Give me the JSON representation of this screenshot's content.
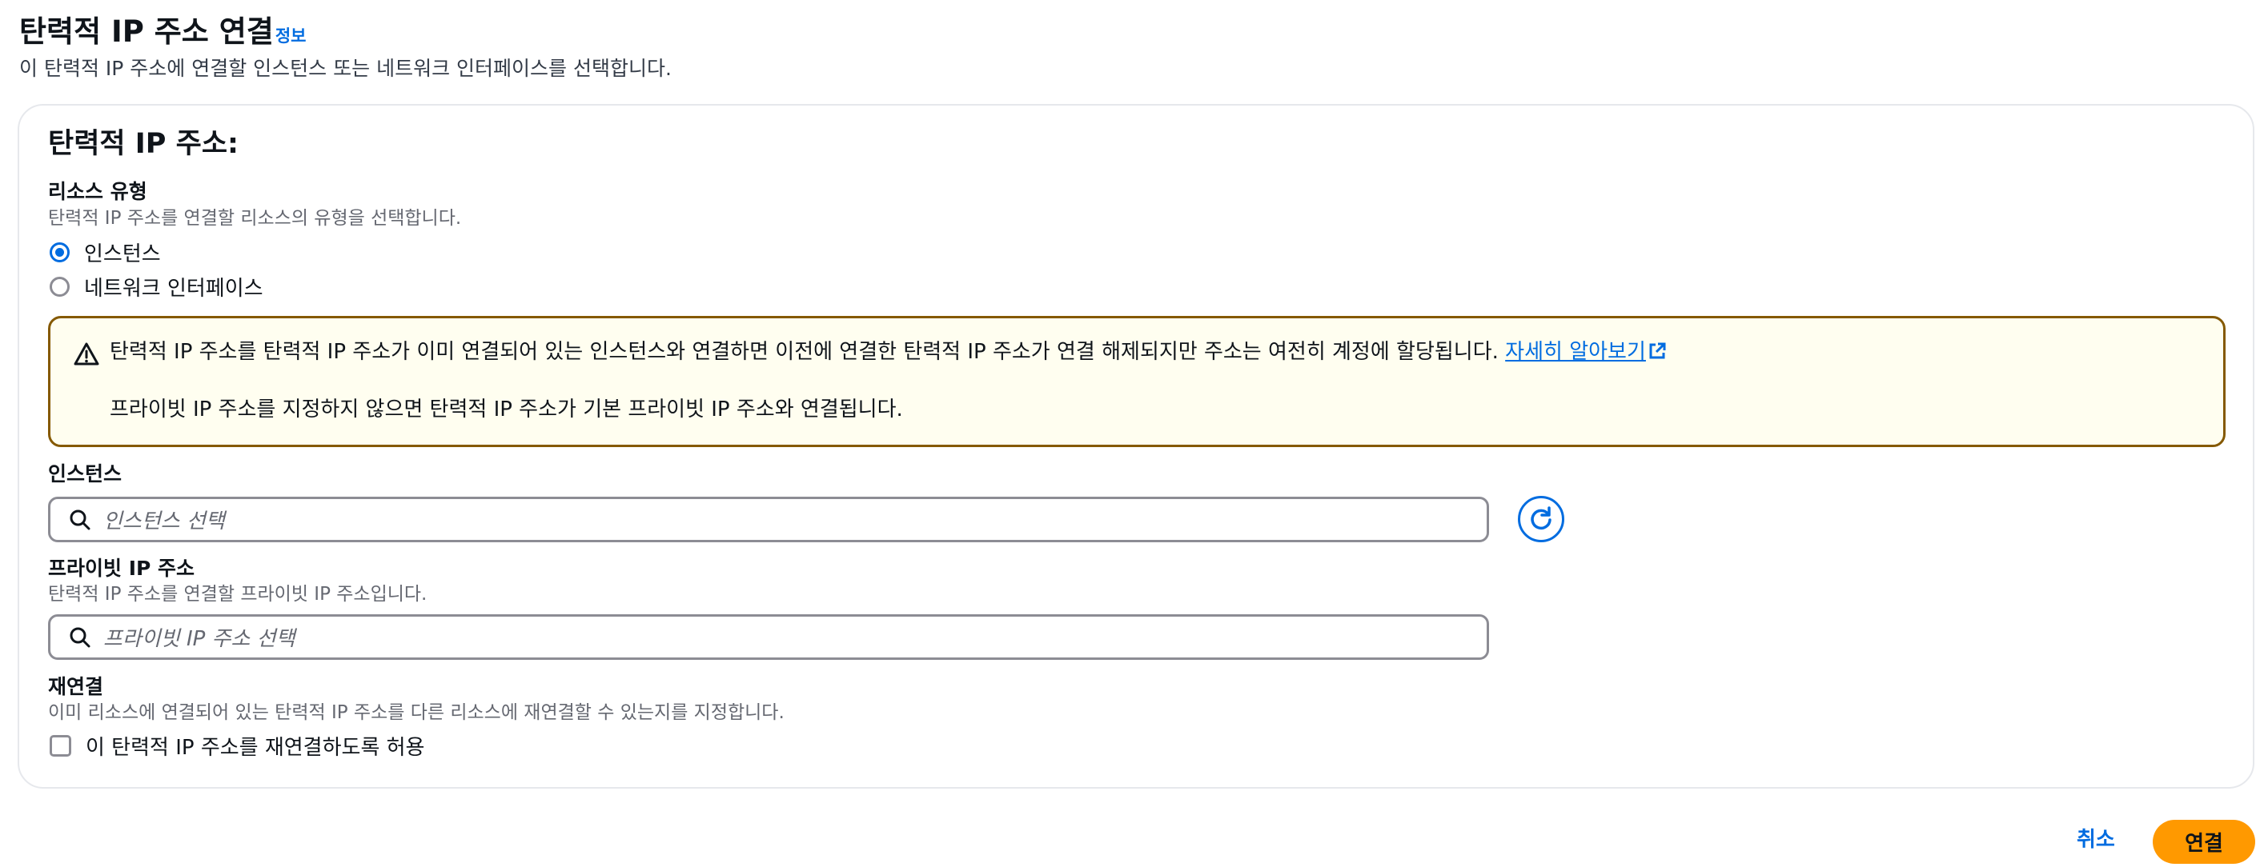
{
  "header": {
    "title": "탄력적 IP 주소 연결",
    "info_link": "정보",
    "description": "이 탄력적 IP 주소에 연결할 인스턴스 또는 네트워크 인터페이스를 선택합니다."
  },
  "section": {
    "title": "탄력적 IP 주소:"
  },
  "resource_type": {
    "label": "리소스 유형",
    "description": "탄력적 IP 주소를 연결할 리소스의 유형을 선택합니다.",
    "options": [
      {
        "label": "인스턴스",
        "checked": true
      },
      {
        "label": "네트워크 인터페이스",
        "checked": false
      }
    ]
  },
  "alert": {
    "line1": "탄력적 IP 주소를 탄력적 IP 주소가 이미 연결되어 있는 인스턴스와 연결하면 이전에 연결한 탄력적 IP 주소가 연결 해제되지만 주소는 여전히 계정에 할당됩니다.",
    "link": "자세히 알아보기",
    "line2": "프라이빗 IP 주소를 지정하지 않으면 탄력적 IP 주소가 기본 프라이빗 IP 주소와 연결됩니다.",
    "icon": "warning-icon",
    "color": "#855900"
  },
  "instance": {
    "label": "인스턴스",
    "placeholder": "인스턴스 선택"
  },
  "private_ip": {
    "label": "프라이빗 IP 주소",
    "description": "탄력적 IP 주소를 연결할 프라이빗 IP 주소입니다.",
    "placeholder": "프라이빗 IP 주소 선택"
  },
  "reassociation": {
    "label": "재연결",
    "description": "이미 리소스에 연결되어 있는 탄력적 IP 주소를 다른 리소스에 재연결할 수 있는지를 지정합니다.",
    "checkbox_label": "이 탄력적 IP 주소를 재연결하도록 허용",
    "checked": false
  },
  "actions": {
    "cancel": "취소",
    "submit": "연결"
  },
  "colors": {
    "accent": "#006ce0",
    "primary_button": "#ff9900"
  }
}
